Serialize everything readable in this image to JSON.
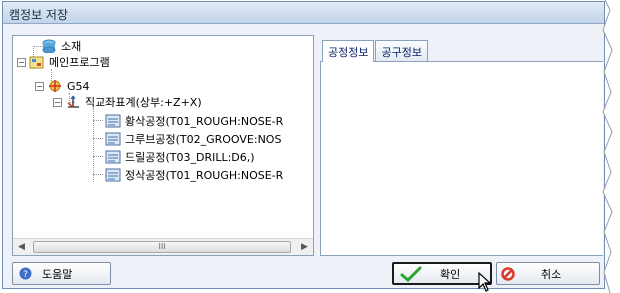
{
  "window": {
    "title": "캠정보 저장"
  },
  "tree": {
    "items": [
      {
        "label": "소재",
        "icon": "stock-icon"
      },
      {
        "label": "메인프로그램",
        "icon": "main-program-icon"
      },
      {
        "label": "G54",
        "icon": "coordinate-icon"
      },
      {
        "label": "직교좌표계(상부:+Z+X)",
        "icon": "axis-icon"
      },
      {
        "label": "황삭공정(T01_ROUGH:NOSE-R",
        "icon": "process-icon"
      },
      {
        "label": "그루브공정(T02_GROOVE:NOS",
        "icon": "process-icon"
      },
      {
        "label": "드릴공정(T03_DRILL:D6,)",
        "icon": "process-icon"
      },
      {
        "label": "정삭공정(T01_ROUGH:NOSE-R",
        "icon": "process-icon"
      }
    ],
    "scrollbar_thumb": "III"
  },
  "tabs": [
    {
      "label": "공정정보",
      "active": true
    },
    {
      "label": "공구정보",
      "active": false
    }
  ],
  "buttons": {
    "help": "도움말",
    "ok": "확인",
    "cancel": "취소"
  },
  "colors": {
    "tab_text": "#0a1e63",
    "title_bg": "#c3d4ea",
    "ok_check": "#2ea52e",
    "cancel_icon": "#d93a2b",
    "help_icon": "#3f6fc6"
  }
}
